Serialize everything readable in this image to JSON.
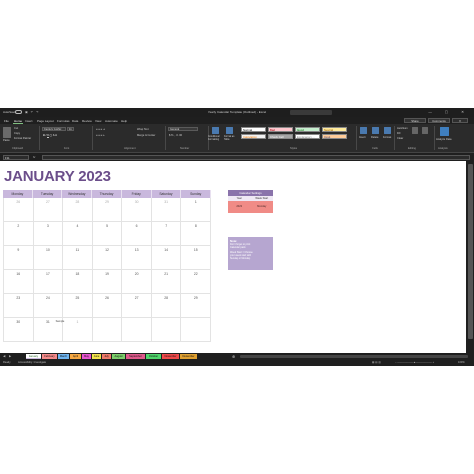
{
  "titlebar": {
    "autosave_label": "AutoSave",
    "doc_title": "Yearly Calendar Template (Outlined) - Excel",
    "search_placeholder": "",
    "window_controls": "—  ▢  ✕"
  },
  "menu": {
    "tabs": [
      "File",
      "Home",
      "Insert",
      "Page Layout",
      "Formulas",
      "Data",
      "Review",
      "View",
      "Automate",
      "Help"
    ],
    "active_tab": "Home",
    "share_label": "Share",
    "comments_label": "Comments"
  },
  "ribbon": {
    "clipboard": {
      "paste": "Paste",
      "cut": "Cut",
      "copy": "Copy",
      "format_painter": "Format Painter",
      "group": "Clipboard"
    },
    "font": {
      "name": "Century Gothic",
      "size": "11",
      "group": "Font"
    },
    "alignment": {
      "wrap": "Wrap Text",
      "merge": "Merge & Center",
      "group": "Alignment"
    },
    "number": {
      "format": "General",
      "group": "Number"
    },
    "styles": {
      "conditional": "Conditional Formatting",
      "format_table": "Format as Table",
      "cells": [
        {
          "label": "Normal",
          "bg": "#ffffff",
          "fg": "#000000"
        },
        {
          "label": "Bad",
          "bg": "#ffc7ce",
          "fg": "#9c0006"
        },
        {
          "label": "Good",
          "bg": "#c6efce",
          "fg": "#006100"
        },
        {
          "label": "Neutral",
          "bg": "#ffeb9c",
          "fg": "#9c5700"
        },
        {
          "label": "Calculation",
          "bg": "#f2f2f2",
          "fg": "#fa7d00"
        },
        {
          "label": "Check Cell",
          "bg": "#a5a5a5",
          "fg": "#ffffff"
        },
        {
          "label": "Explanatory ...",
          "bg": "#ffffff",
          "fg": "#7f7f7f"
        },
        {
          "label": "Input",
          "bg": "#ffcc99",
          "fg": "#3f3f76"
        }
      ],
      "group": "Styles"
    },
    "cells": {
      "insert": "Insert",
      "delete": "Delete",
      "format": "Format",
      "group": "Cells"
    },
    "editing": {
      "autosum": "AutoSum",
      "fill": "Fill",
      "clear": "Clear",
      "sort": "Sort & Filter",
      "find": "Find & Select",
      "group": "Editing"
    },
    "analysis": {
      "analyze": "Analyze Data",
      "group": "Analysis"
    }
  },
  "formula_bar": {
    "name_box": "F11",
    "fx": "fx",
    "content": ""
  },
  "calendar": {
    "title": "JANUARY 2023",
    "days": [
      "Monday",
      "Tuesday",
      "Wednesday",
      "Thursday",
      "Friday",
      "Saturday",
      "Sunday"
    ],
    "weeks": [
      [
        "26",
        "27",
        "28",
        "29",
        "30",
        "31",
        "1"
      ],
      [
        "2",
        "3",
        "4",
        "5",
        "6",
        "7",
        "8"
      ],
      [
        "9",
        "10",
        "11",
        "12",
        "13",
        "14",
        "15"
      ],
      [
        "16",
        "17",
        "18",
        "19",
        "20",
        "21",
        "22"
      ],
      [
        "23",
        "24",
        "25",
        "26",
        "27",
        "28",
        "29"
      ],
      [
        "30",
        "31",
        "1",
        "",
        "",
        "",
        ""
      ]
    ],
    "dim_week0": [
      true,
      true,
      true,
      true,
      true,
      true,
      false
    ],
    "note_text": "Sample"
  },
  "settings": {
    "title": "Calendar Settings",
    "col1": "Year",
    "col2": "Week Start",
    "val1": "2023",
    "val2": "Monday"
  },
  "notes": {
    "title": "Note:",
    "lines": [
      "Don't forget to print",
      "Calendar pack.",
      "",
      "Week Start = Choose",
      "your week start with",
      "Sunday or Monday."
    ]
  },
  "sheet_tabs": [
    {
      "label": "January",
      "color": "#c9b8dd",
      "active": true
    },
    {
      "label": "February",
      "color": "#f58a8a"
    },
    {
      "label": "March",
      "color": "#6fb5f0"
    },
    {
      "label": "April",
      "color": "#f5a742"
    },
    {
      "label": "May",
      "color": "#e855d0"
    },
    {
      "label": "June",
      "color": "#f2e24a"
    },
    {
      "label": "July",
      "color": "#f07a6a"
    },
    {
      "label": "August",
      "color": "#7ccf6b"
    },
    {
      "label": "September",
      "color": "#e05a8c"
    },
    {
      "label": "October",
      "color": "#4fd66b"
    },
    {
      "label": "November",
      "color": "#f04a4a"
    },
    {
      "label": "December",
      "color": "#e0a030"
    }
  ],
  "status": {
    "ready": "Ready",
    "accessibility": "Accessibility: Investigate",
    "zoom": "100%"
  }
}
